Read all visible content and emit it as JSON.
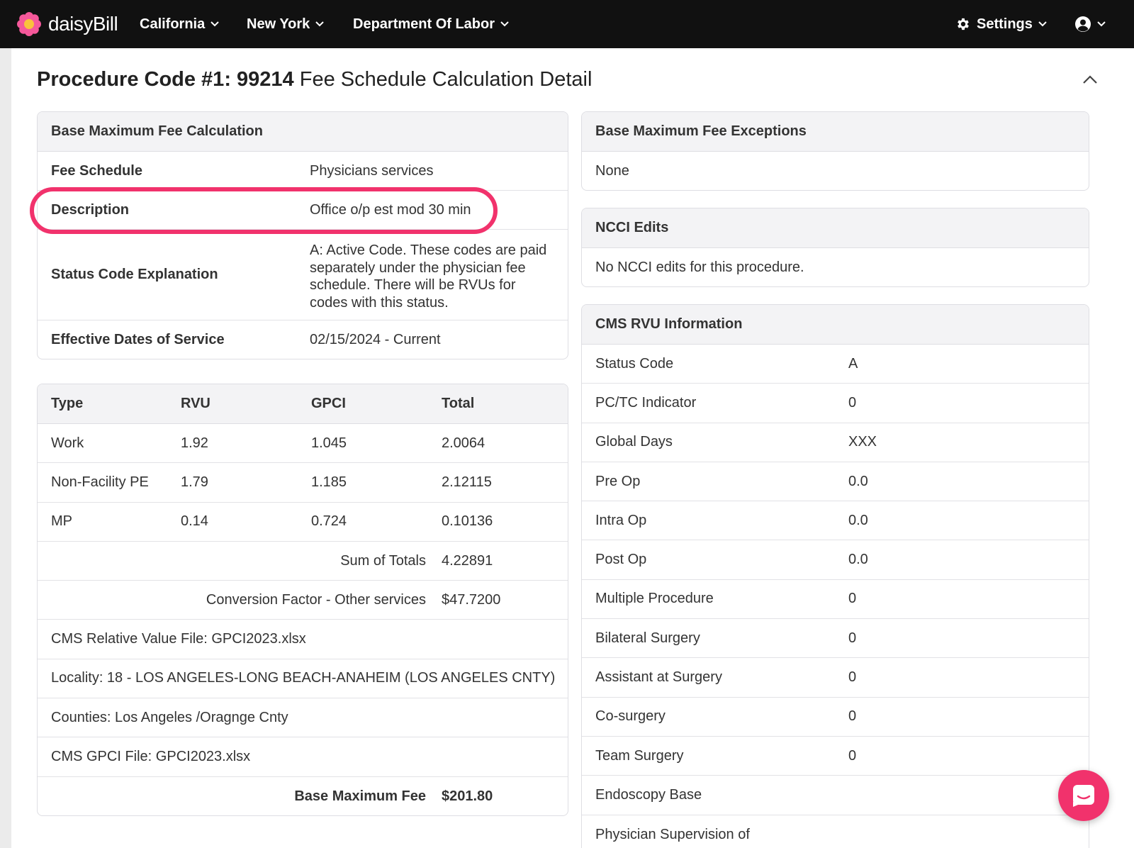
{
  "nav": {
    "brand": "daisyBill",
    "items": [
      {
        "label": "California"
      },
      {
        "label": "New York"
      },
      {
        "label": "Department Of Labor"
      }
    ],
    "settings_label": "Settings"
  },
  "page": {
    "title_strong": "Procedure Code #1: 99214",
    "title_rest": " Fee Schedule Calculation Detail"
  },
  "base_calc": {
    "heading": "Base Maximum Fee Calculation",
    "rows": [
      {
        "label": "Fee Schedule",
        "value": "Physicians services"
      },
      {
        "label": "Description",
        "value": "Office o/p est mod 30 min"
      },
      {
        "label": "Status Code Explanation",
        "value": "A: Active Code. These codes are paid separately under the physician fee schedule. There will be RVUs for codes with this status."
      },
      {
        "label": "Effective Dates of Service",
        "value": "02/15/2024 - Current"
      }
    ]
  },
  "rvu_table": {
    "headers": [
      "Type",
      "RVU",
      "GPCI",
      "Total"
    ],
    "rows": [
      {
        "type": "Work",
        "rvu": "1.92",
        "gpci": "1.045",
        "total": "2.0064"
      },
      {
        "type": "Non-Facility PE",
        "rvu": "1.79",
        "gpci": "1.185",
        "total": "2.12115"
      },
      {
        "type": "MP",
        "rvu": "0.14",
        "gpci": "0.724",
        "total": "0.10136"
      }
    ],
    "sum_label": "Sum of Totals",
    "sum_value": "4.22891",
    "conversion_label": "Conversion Factor - Other services",
    "conversion_value": "$47.7200",
    "notes": [
      "CMS Relative Value File: GPCI2023.xlsx",
      "Locality: 18 - LOS ANGELES-LONG BEACH-ANAHEIM (LOS ANGELES CNTY)",
      "Counties: Los Angeles /Oragnge Cnty",
      "CMS GPCI File: GPCI2023.xlsx"
    ],
    "base_max_label": "Base Maximum Fee",
    "base_max_value": "$201.80"
  },
  "exceptions": {
    "heading": "Base Maximum Fee Exceptions",
    "value": "None"
  },
  "ncci": {
    "heading": "NCCI Edits",
    "value": "No NCCI edits for this procedure."
  },
  "cms_rvu": {
    "heading": "CMS RVU Information",
    "rows": [
      {
        "label": "Status Code",
        "value": "A"
      },
      {
        "label": "PC/TC Indicator",
        "value": "0"
      },
      {
        "label": "Global Days",
        "value": "XXX"
      },
      {
        "label": "Pre Op",
        "value": "0.0"
      },
      {
        "label": "Intra Op",
        "value": "0.0"
      },
      {
        "label": "Post Op",
        "value": "0.0"
      },
      {
        "label": "Multiple Procedure",
        "value": "0"
      },
      {
        "label": "Bilateral Surgery",
        "value": "0"
      },
      {
        "label": "Assistant at Surgery",
        "value": "0"
      },
      {
        "label": "Co-surgery",
        "value": "0"
      },
      {
        "label": "Team Surgery",
        "value": "0"
      },
      {
        "label": "Endoscopy Base",
        "value": ""
      },
      {
        "label": "Physician Supervision of",
        "value": ""
      }
    ]
  },
  "colors": {
    "navbar": "#111111",
    "accent": "#f1326c",
    "panel_header": "#f3f3f5"
  }
}
